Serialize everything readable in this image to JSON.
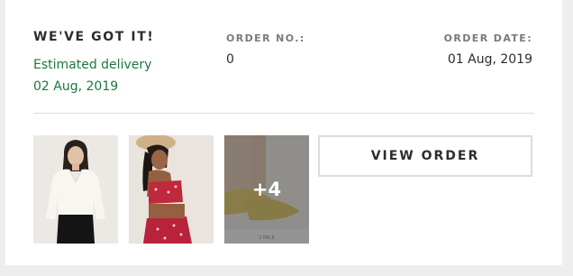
{
  "status": {
    "title": "WE'VE GOT IT!",
    "delivery_label": "Estimated delivery",
    "delivery_date": "02 Aug, 2019"
  },
  "order": {
    "number_label": "ORDER NO.:",
    "number_value": "0",
    "date_label": "ORDER DATE:",
    "date_value": "01 Aug, 2019"
  },
  "items": {
    "thumbnails": [
      {
        "icon": "product-image-white-sweater"
      },
      {
        "icon": "product-image-red-floral-set"
      },
      {
        "icon": "product-image-yellow-sandals"
      }
    ],
    "more_count": "+4",
    "pack_label": "2 PACK"
  },
  "actions": {
    "view_order_label": "VIEW ORDER"
  },
  "colors": {
    "delivery_green": "#1a7a3c",
    "text_dark": "#2d2d2d",
    "label_gray": "#7a7a7a",
    "page_background": "#eeeeee"
  }
}
